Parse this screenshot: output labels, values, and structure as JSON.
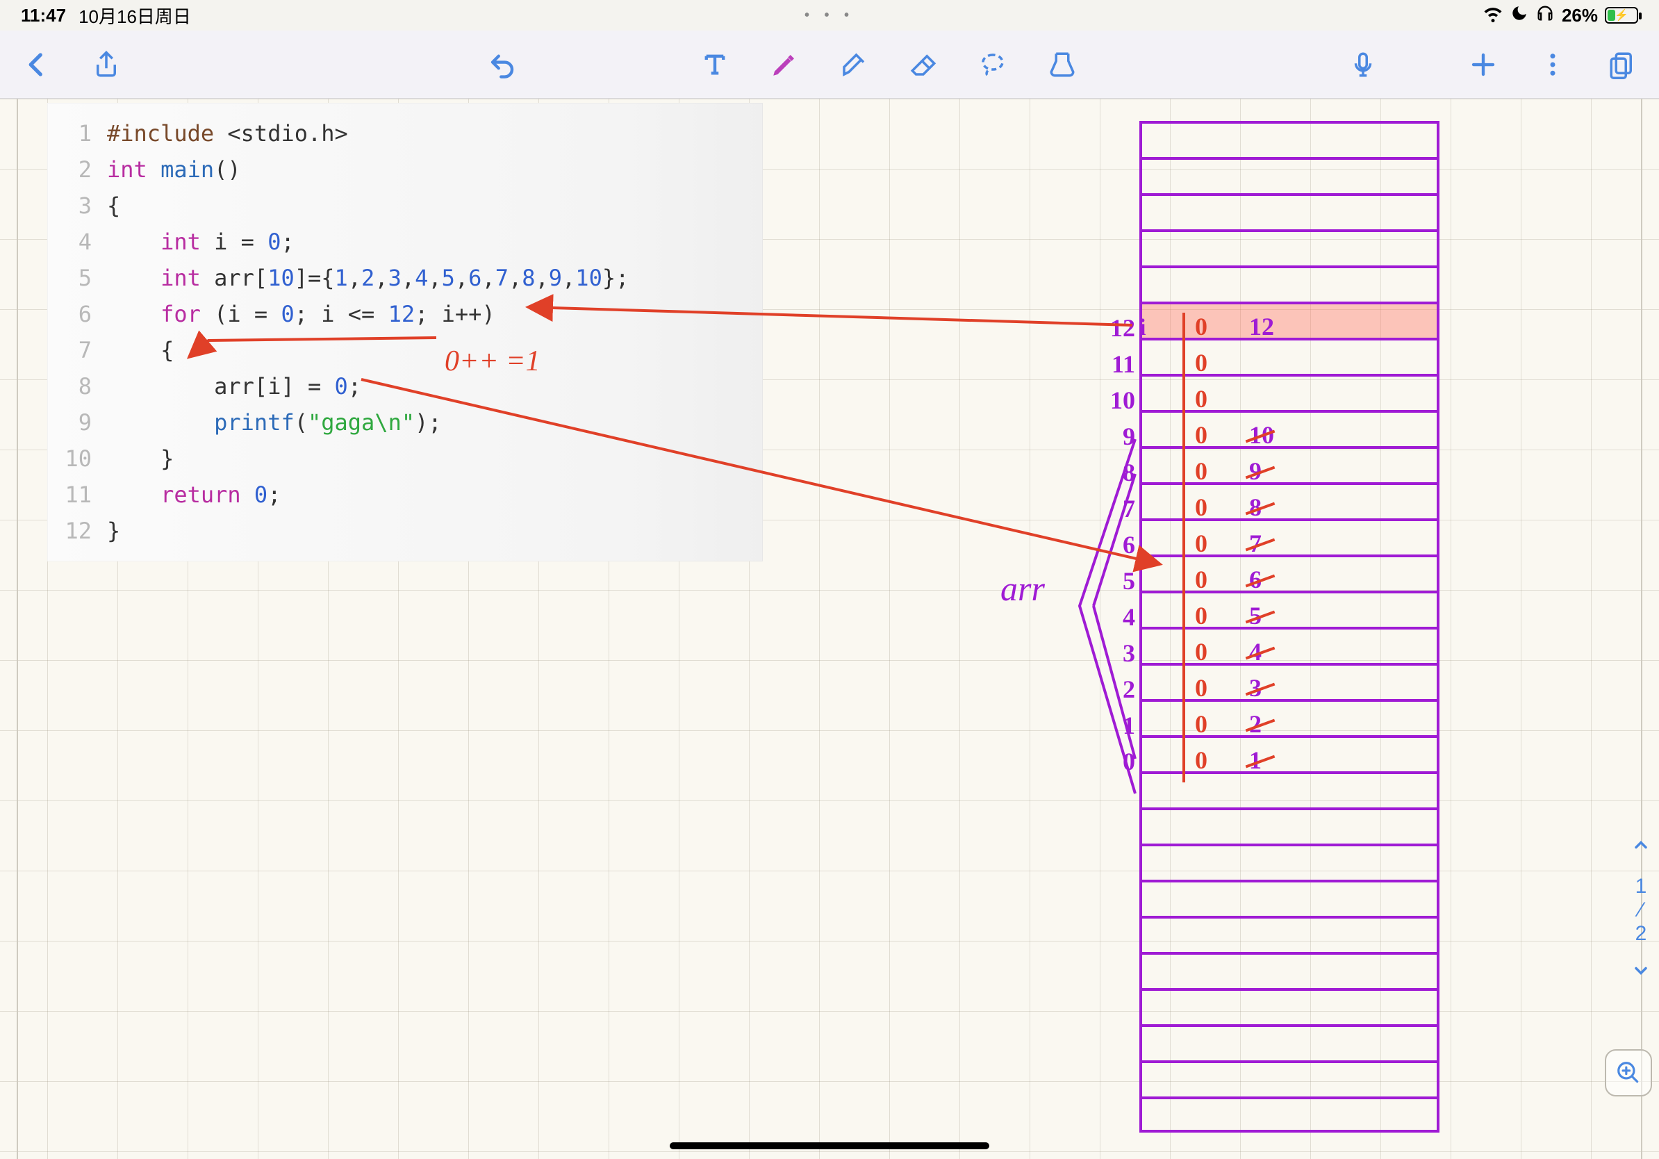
{
  "statusbar": {
    "time": "11:47",
    "date": "10月16日周日",
    "center_dots": "• • •",
    "battery_pct": "26%"
  },
  "toolbar": {
    "back": "返回",
    "share": "分享",
    "undo": "撤销",
    "text_tool": "文本",
    "pen_tool": "笔",
    "highlighter_tool": "荧光笔",
    "eraser_tool": "橡皮",
    "lasso_tool": "套索",
    "shape_tool": "形状",
    "mic_tool": "录音",
    "add": "添加",
    "more": "更多",
    "pages": "页面"
  },
  "code": {
    "lines": [
      {
        "n": "1",
        "tokens": [
          [
            "pre",
            "#include "
          ],
          [
            "sym",
            "<stdio.h>"
          ]
        ]
      },
      {
        "n": "2",
        "tokens": [
          [
            "kw",
            "int "
          ],
          [
            "fun",
            "main"
          ],
          [
            "sym",
            "()"
          ]
        ]
      },
      {
        "n": "3",
        "tokens": [
          [
            "sym",
            "{"
          ]
        ]
      },
      {
        "n": "4",
        "tokens": [
          [
            "sym",
            "    "
          ],
          [
            "kw",
            "int "
          ],
          [
            "id",
            "i "
          ],
          [
            "sym",
            "= "
          ],
          [
            "num",
            "0"
          ],
          [
            "sym",
            ";"
          ]
        ]
      },
      {
        "n": "5",
        "tokens": [
          [
            "sym",
            "    "
          ],
          [
            "kw",
            "int "
          ],
          [
            "id",
            "arr"
          ],
          [
            "sym",
            "["
          ],
          [
            "num",
            "10"
          ],
          [
            "sym",
            "]={"
          ],
          [
            "num",
            "1"
          ],
          [
            "sym",
            ","
          ],
          [
            "num",
            "2"
          ],
          [
            "sym",
            ","
          ],
          [
            "num",
            "3"
          ],
          [
            "sym",
            ","
          ],
          [
            "num",
            "4"
          ],
          [
            "sym",
            ","
          ],
          [
            "num",
            "5"
          ],
          [
            "sym",
            ","
          ],
          [
            "num",
            "6"
          ],
          [
            "sym",
            ","
          ],
          [
            "num",
            "7"
          ],
          [
            "sym",
            ","
          ],
          [
            "num",
            "8"
          ],
          [
            "sym",
            ","
          ],
          [
            "num",
            "9"
          ],
          [
            "sym",
            ","
          ],
          [
            "num",
            "10"
          ],
          [
            "sym",
            "};"
          ]
        ]
      },
      {
        "n": "6",
        "tokens": [
          [
            "sym",
            "    "
          ],
          [
            "kw",
            "for "
          ],
          [
            "sym",
            "(i = "
          ],
          [
            "num",
            "0"
          ],
          [
            "sym",
            "; i <= "
          ],
          [
            "num",
            "12"
          ],
          [
            "sym",
            "; i++)"
          ]
        ]
      },
      {
        "n": "7",
        "tokens": [
          [
            "sym",
            "    {"
          ]
        ]
      },
      {
        "n": "8",
        "tokens": [
          [
            "sym",
            "        arr[i] = "
          ],
          [
            "num",
            "0"
          ],
          [
            "sym",
            ";"
          ]
        ]
      },
      {
        "n": "9",
        "tokens": [
          [
            "sym",
            "        "
          ],
          [
            "fun",
            "printf"
          ],
          [
            "sym",
            "("
          ],
          [
            "strg",
            "\"gaga\\n\""
          ],
          [
            "sym",
            ");"
          ]
        ]
      },
      {
        "n": "10",
        "tokens": [
          [
            "sym",
            "    }"
          ]
        ]
      },
      {
        "n": "11",
        "tokens": [
          [
            "sym",
            "    "
          ],
          [
            "kw",
            "return "
          ],
          [
            "num",
            "0"
          ],
          [
            "sym",
            ";"
          ]
        ]
      },
      {
        "n": "12",
        "tokens": [
          [
            "sym",
            "}"
          ]
        ]
      }
    ]
  },
  "annotations": {
    "red_note": "0++ =1",
    "arr_label": "arr",
    "i_tag": "i",
    "indices": [
      "12",
      "11",
      "10",
      "9",
      "8",
      "7",
      "6",
      "5",
      "4",
      "3",
      "2",
      "1",
      "0"
    ],
    "zeros": [
      "0",
      "0",
      "0",
      "0",
      "0",
      "0",
      "0",
      "0",
      "0",
      "0",
      "0",
      "0",
      "0"
    ],
    "old_vals": [
      "12",
      "",
      "",
      "10",
      "9",
      "8",
      "7",
      "6",
      "5",
      "4",
      "3",
      "2",
      "1"
    ],
    "old_strike": [
      false,
      false,
      false,
      true,
      true,
      true,
      true,
      true,
      true,
      true,
      true,
      true,
      true
    ]
  },
  "pagenav": {
    "cur": "1",
    "sep": "⁄",
    "total": "2"
  }
}
